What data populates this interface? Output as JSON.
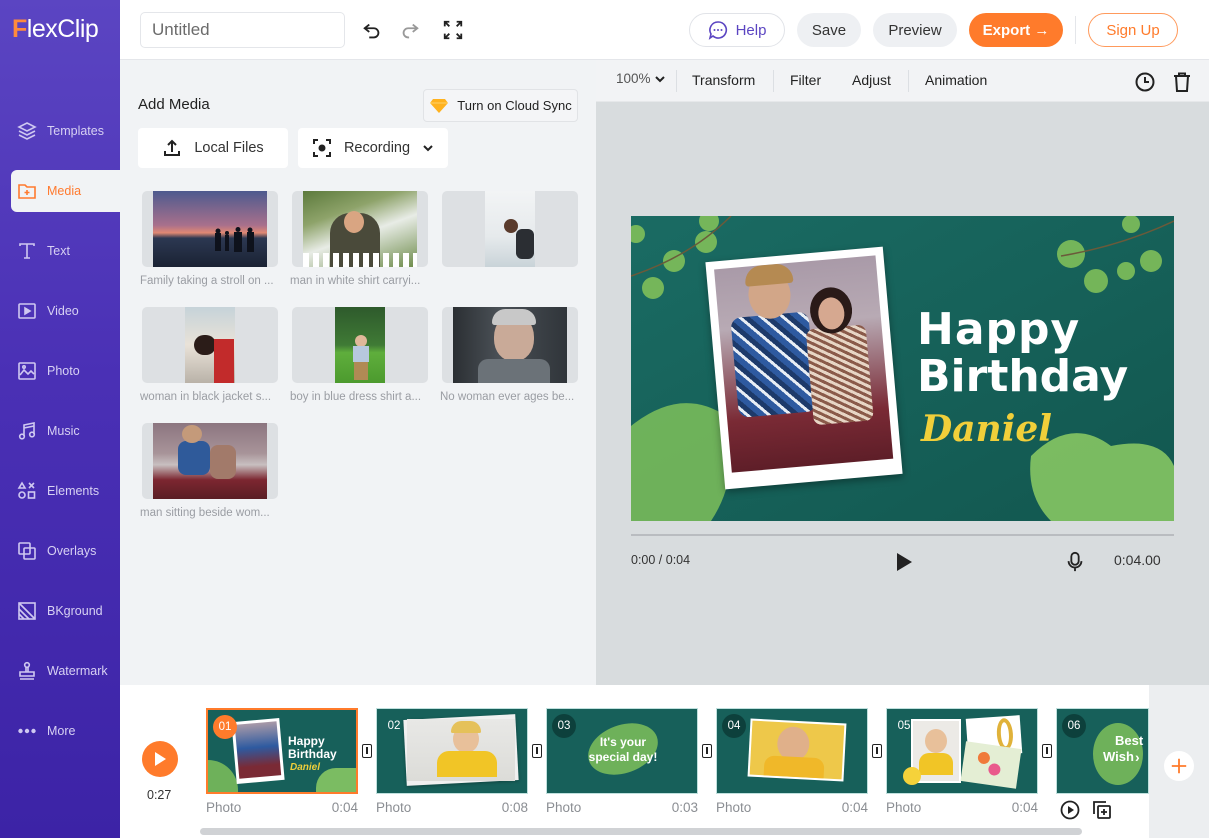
{
  "app": {
    "logo_first": "F",
    "logo_rest": "lexClip",
    "brand_color": "#5b45c2",
    "accent_color": "#ff7b2b"
  },
  "topbar": {
    "title_value": "Untitled",
    "help_label": "Help",
    "save_label": "Save",
    "preview_label": "Preview",
    "export_label": "Export →",
    "signup_label": "Sign Up"
  },
  "sidebar": {
    "items": [
      {
        "label": "Templates",
        "icon": "layers-icon"
      },
      {
        "label": "Media",
        "icon": "folder-plus-icon",
        "active": true
      },
      {
        "label": "Text",
        "icon": "text-icon"
      },
      {
        "label": "Video",
        "icon": "video-icon"
      },
      {
        "label": "Photo",
        "icon": "photo-icon"
      },
      {
        "label": "Music",
        "icon": "music-icon"
      },
      {
        "label": "Elements",
        "icon": "shapes-icon"
      },
      {
        "label": "Overlays",
        "icon": "overlays-icon"
      },
      {
        "label": "BKground",
        "icon": "background-icon"
      },
      {
        "label": "Watermark",
        "icon": "stamp-icon"
      },
      {
        "label": "More",
        "icon": "more-icon"
      }
    ]
  },
  "media_panel": {
    "title": "Add Media",
    "cloud_sync_label": "Turn on Cloud Sync",
    "local_files_label": "Local Files",
    "recording_label": "Recording",
    "items": [
      {
        "caption": "Family taking a stroll on ..."
      },
      {
        "caption": "man in white shirt carryi..."
      },
      {
        "caption": ""
      },
      {
        "caption": "woman in black jacket s..."
      },
      {
        "caption": "boy in blue dress shirt a..."
      },
      {
        "caption": "No woman ever ages be..."
      },
      {
        "caption": "man sitting beside wom..."
      }
    ]
  },
  "editor": {
    "zoom_label": "100%",
    "tools": [
      "Transform",
      "Filter",
      "Adjust",
      "Animation"
    ],
    "canvas": {
      "line1": "Happy",
      "line2": "Birthday",
      "name": "Daniel"
    },
    "current_time": "0:00 / 0:04",
    "clip_duration": "0:04.00",
    "playback_progress": 0
  },
  "timeline": {
    "total_duration": "0:27",
    "clips": [
      {
        "num": "01",
        "type": "Photo",
        "duration": "0:04",
        "text1": "Happy",
        "text2": "Birthday",
        "text3": "Daniel",
        "active": true
      },
      {
        "num": "02",
        "type": "Photo",
        "duration": "0:08"
      },
      {
        "num": "03",
        "type": "Photo",
        "duration": "0:03",
        "text1": "It's your",
        "text2": "special day!"
      },
      {
        "num": "04",
        "type": "Photo",
        "duration": "0:04"
      },
      {
        "num": "05",
        "type": "Photo",
        "duration": "0:04"
      },
      {
        "num": "06",
        "type": "",
        "duration": "",
        "text1": "Best",
        "text2": "Wish"
      }
    ]
  }
}
